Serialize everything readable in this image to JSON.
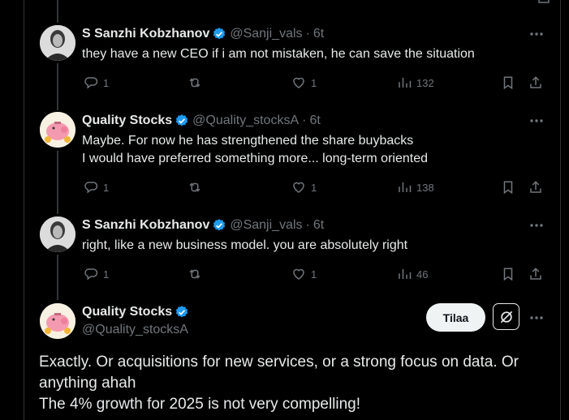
{
  "replies": [
    {
      "name": "S Sanzhi Kobzhanov",
      "handle": "@Sanji_vals",
      "time": "6t",
      "lines": [
        "they have a new CEO if i am not mistaken, he can save the situation"
      ],
      "stats": {
        "replies": "1",
        "reposts": "",
        "likes": "1",
        "views": "132"
      }
    },
    {
      "name": "Quality Stocks",
      "handle": "@Quality_stocksA",
      "time": "6t",
      "lines": [
        "Maybe. For now he has strengthened the share buybacks",
        "I would have preferred something more... long-term oriented"
      ],
      "stats": {
        "replies": "1",
        "reposts": "",
        "likes": "1",
        "views": "138"
      }
    },
    {
      "name": "S Sanzhi Kobzhanov",
      "handle": "@Sanji_vals",
      "time": "6t",
      "lines": [
        "right, like a new business model. you are absolutely right"
      ],
      "stats": {
        "replies": "1",
        "reposts": "",
        "likes": "1",
        "views": "46"
      }
    }
  ],
  "main_post": {
    "name": "Quality Stocks",
    "handle": "@Quality_stocksA",
    "subscribe_label": "Tilaa",
    "lines": [
      "Exactly. Or acquisitions for new services, or a strong focus on data. Or",
      "anything ahah",
      "The 4% growth for 2025 is not very compelling!"
    ]
  },
  "colors": {
    "background": "#000000",
    "text": "#e7e9ea",
    "muted": "#71767b",
    "verified": "#1d9bf0"
  },
  "icons": [
    "reply-icon",
    "repost-icon",
    "like-icon",
    "views-icon",
    "bookmark-icon",
    "share-icon",
    "more-icon",
    "verified-icon",
    "grok-icon"
  ]
}
